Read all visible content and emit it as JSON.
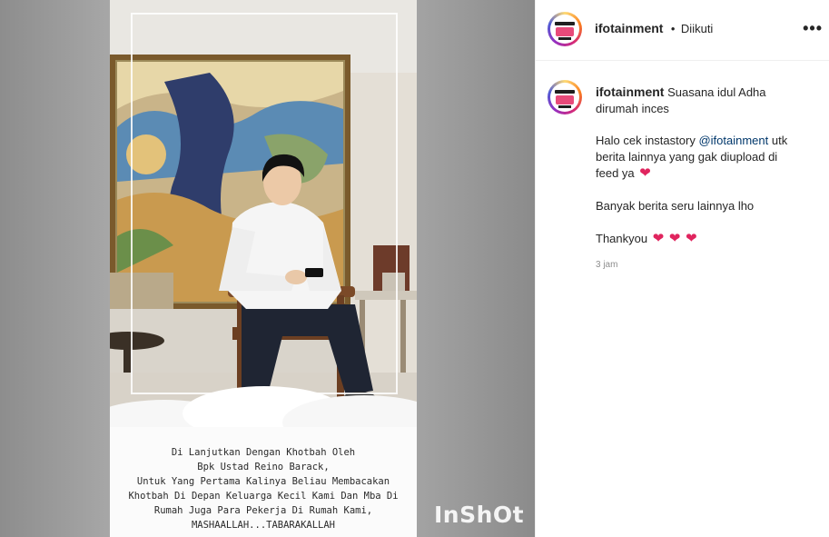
{
  "post": {
    "account": "ifotainment",
    "separator": "•",
    "follow_status": "Diikuti",
    "more_glyph": "•••"
  },
  "caption": {
    "username": "ifotainment",
    "line1": "Suasana idul Adha",
    "line2": "dirumah inces",
    "para2_a": "Halo cek instastory ",
    "para2_mention": "@ifotainment",
    "para2_b": " utk",
    "para2_line2": "berita lainnya yang gak diupload di",
    "para2_line3": "feed ya",
    "para3": "Banyak berita seru lainnya lho",
    "para4": "Thankyou",
    "heart_glyph": "❤",
    "time": "3 jam"
  },
  "video": {
    "overlay_lines": [
      "Di Lanjutkan Dengan Khotbah Oleh",
      "Bpk Ustad Reino Barack,",
      "Untuk Yang Pertama Kalinya Beliau Membacakan",
      "Khotbah Di Depan Keluarga Kecil Kami Dan Mba Di",
      "Rumah Juga Para Pekerja Di Rumah Kami,",
      "MASHAALLAH...TABARAKALLAH"
    ],
    "watermark": "InShOt"
  },
  "colors": {
    "link": "#00376b",
    "heart": "#e0245e",
    "text": "#262626",
    "muted": "#8e8e8e"
  }
}
